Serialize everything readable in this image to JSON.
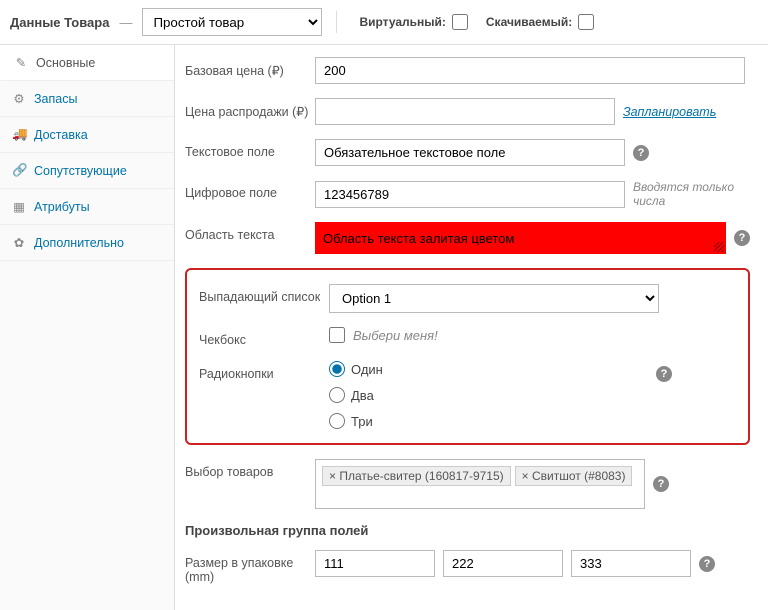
{
  "header": {
    "title": "Данные Товара",
    "dash": "—",
    "product_type": "Простой товар",
    "virtual_label": "Виртуальный:",
    "downloadable_label": "Скачиваемый:"
  },
  "sidebar": {
    "items": [
      {
        "icon": "✎",
        "label": "Основные"
      },
      {
        "icon": "⚙",
        "label": "Запасы"
      },
      {
        "icon": "🚚",
        "label": "Доставка"
      },
      {
        "icon": "🔗",
        "label": "Сопутствующие"
      },
      {
        "icon": "▦",
        "label": "Атрибуты"
      },
      {
        "icon": "✿",
        "label": "Дополнительно"
      }
    ]
  },
  "fields": {
    "regular_price": {
      "label": "Базовая цена (₽)",
      "value": "200"
    },
    "sale_price": {
      "label": "Цена распродажи (₽)",
      "value": "",
      "schedule": "Запланировать"
    },
    "text_field": {
      "label": "Текстовое поле",
      "value": "Обязательное текстовое поле"
    },
    "number_field": {
      "label": "Цифровое поле",
      "value": "123456789",
      "note": "Вводятся только числа"
    },
    "textarea": {
      "label": "Область текста",
      "value": "Область текста залитая цветом"
    },
    "dropdown": {
      "label": "Выпадающий список",
      "value": "Option 1"
    },
    "checkbox": {
      "label": "Чекбокс",
      "caption": "Выбери меня!"
    },
    "radios": {
      "label": "Радиокнопки",
      "options": [
        "Один",
        "Два",
        "Три"
      ]
    },
    "product_select": {
      "label": "Выбор товаров",
      "tags": [
        "× Платье-свитер (160817-9715)",
        "× Свитшот (#8083)"
      ]
    },
    "group_title": "Произвольная группа полей",
    "size": {
      "label": "Размер в упаковке (mm)",
      "values": [
        "111",
        "222",
        "333"
      ]
    }
  }
}
